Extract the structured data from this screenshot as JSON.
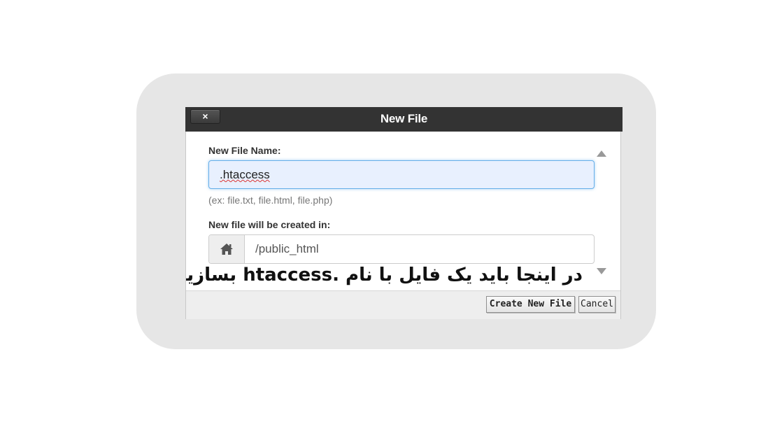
{
  "dialog": {
    "title": "New File",
    "close_label": "×"
  },
  "form": {
    "name_label": "New File Name:",
    "name_value": ".htaccess",
    "name_hint": "(ex: file.txt, file.html, file.php)",
    "location_label": "New file will be created in:",
    "location_value": "/public_html",
    "location_icon": "home-icon"
  },
  "annotation": {
    "text": "در اینجا باید یک فایل با نام .htaccess بسازید"
  },
  "footer": {
    "create_label": "Create New File",
    "cancel_label": "Cancel"
  }
}
